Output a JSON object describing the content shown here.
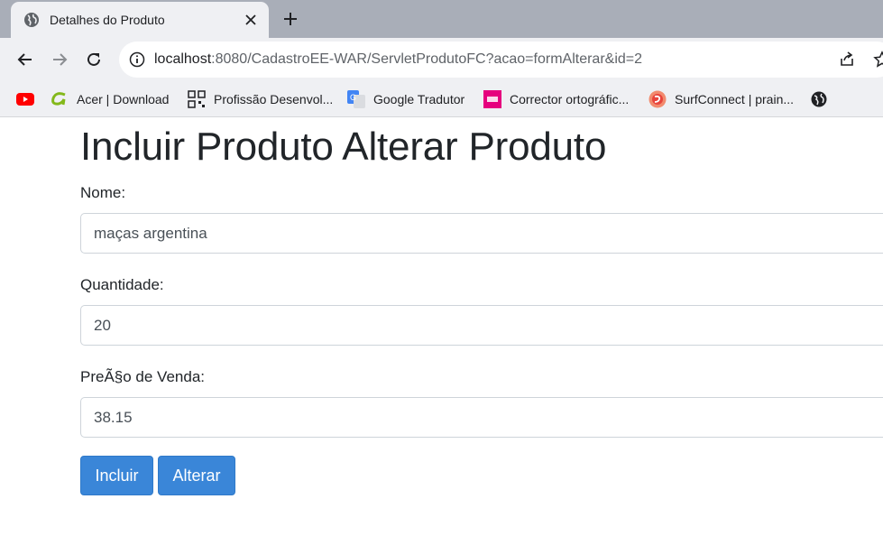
{
  "browser": {
    "tab_title": "Detalhes do Produto",
    "url_host": "localhost",
    "url_rest": ":8080/CadastroEE-WAR/ServletProdutoFC?acao=formAlterar&id=2",
    "bookmarks": [
      {
        "label": "",
        "icon": "youtube-icon"
      },
      {
        "label": "Acer | Download",
        "icon": "acer-icon"
      },
      {
        "label": "Profissão Desenvol...",
        "icon": "qr-icon"
      },
      {
        "label": "Google Tradutor",
        "icon": "translate-icon"
      },
      {
        "label": "Corrector ortográfic...",
        "icon": "flip-icon"
      },
      {
        "label": "SurfConnect | prain...",
        "icon": "surfconnect-icon"
      },
      {
        "label": "",
        "icon": "globe-icon"
      }
    ]
  },
  "page": {
    "heading": "Incluir Produto Alterar Produto",
    "fields": {
      "nome": {
        "label": "Nome:",
        "value": "maças argentina"
      },
      "quantidade": {
        "label": "Quantidade:",
        "value": "20"
      },
      "preco": {
        "label": "PreÃ§o de Venda:",
        "value": "38.15"
      }
    },
    "buttons": {
      "incluir": "Incluir",
      "alterar": "Alterar"
    }
  },
  "colors": {
    "button_primary": "#3a86d8",
    "tabstrip": "#a9aeb8",
    "toolbar": "#eff0f3"
  }
}
